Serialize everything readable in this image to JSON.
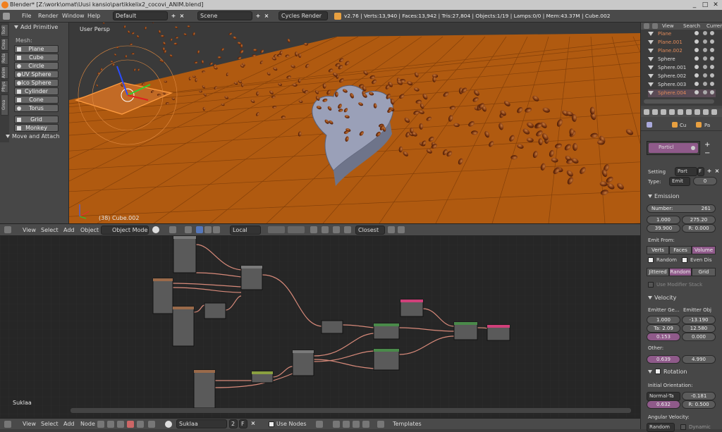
{
  "window": {
    "title": "Blender* [Z:\\work\\omat\\Uusi kansio\\partikkelix2_cocovi_ANIM.blend]",
    "min": "_",
    "max": "□",
    "close": "✕"
  },
  "info_header": {
    "menus": [
      "File",
      "Render",
      "Window",
      "Help"
    ],
    "layout": "Default",
    "scene": "Scene",
    "engine": "Cycles Render",
    "stats": "v2.76 | Verts:13,940 | Faces:13,942 | Tris:27,804 | Objects:1/19 | Lamps:0/0 | Mem:43.37M | Cube.002"
  },
  "toolshelf": {
    "tabs": [
      "Tools",
      "Create",
      "Relations",
      "Animation",
      "Physics",
      "Grease Pencil"
    ],
    "section": "Add Primitive",
    "mesh_label": "Mesh:",
    "mesh_buttons": [
      "Plane",
      "Cube",
      "Circle",
      "UV Sphere",
      "Ico Sphere",
      "Cylinder",
      "Cone",
      "Torus"
    ],
    "other_buttons": [
      "Grid",
      "Monkey"
    ],
    "operator": "Move and Attach"
  },
  "viewport": {
    "label": "User Persp",
    "object_label": "(38) Cube.002",
    "colors": {
      "floor": "#b05a10",
      "heart": "#9aa0b8",
      "bean": "#7a3510"
    }
  },
  "viewport_header": {
    "menus": [
      "View",
      "Select",
      "Add",
      "Object"
    ],
    "mode": "Object Mode",
    "pivot": "Local",
    "snap": "Closest"
  },
  "node_editor": {
    "label": "Suklaa"
  },
  "node_header": {
    "menus": [
      "View",
      "Select",
      "Add",
      "Node"
    ],
    "material": "Suklaa",
    "users": "2",
    "fake": "F",
    "use_nodes": "Use Nodes",
    "templates": "Templates"
  },
  "outliner": {
    "menus": [
      "View",
      "Search",
      "Current"
    ],
    "items": [
      "Plane",
      "Plane.001",
      "Plane.002",
      "Sphere",
      "Sphere.001",
      "Sphere.002",
      "Sphere.003",
      "Sphere.004"
    ]
  },
  "properties": {
    "tabs": [
      "Cu",
      "Pa"
    ],
    "slot": "Particl",
    "settings_label": "Setting",
    "settings_value": "Part",
    "settings_flag": "F",
    "type_label": "Type:",
    "type_value": "Emit",
    "type_num": "0",
    "emission": "Emission",
    "number_label": "Number:",
    "number_value": "261",
    "start": "1.000",
    "end": "275.20",
    "lifetime": "39.900",
    "random": "R: 0.000",
    "emit_from": "Emit From:",
    "emit_segs": [
      "Verts",
      "Faces",
      "Volume"
    ],
    "random_chk": "Random",
    "even_chk": "Even Dis",
    "dist_segs": [
      "Jittered",
      "Random",
      "Grid"
    ],
    "modifier_stack": "Use Modifier Stack",
    "velocity": "Velocity",
    "emitter_geo": "Emitter Ge...",
    "emitter_obj": "Emitter Obj",
    "eg1": "1.000",
    "eo1": "-13.190",
    "eg2": "Ta: 2.09",
    "eo2": "12.580",
    "eg3": "0.153",
    "eo3": "0.000",
    "other": "Other:",
    "other1": "0.639",
    "other2": "4.990",
    "rotation": "Rotation",
    "init_orient": "Initial Orientation:",
    "orient_value": "Normal-Ta",
    "orient_num": "-0.181",
    "orient_a": "0.632",
    "orient_r": "R: 0.500",
    "ang_vel": "Angular Velocity:",
    "ang_value": "Random",
    "dynamic": "Dynamic"
  }
}
